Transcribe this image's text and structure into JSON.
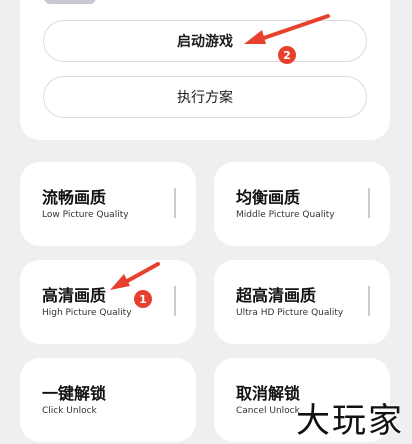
{
  "actions": {
    "launch_label": "启动游戏",
    "plan_label": "执行方案"
  },
  "tiles": [
    {
      "title": "流畅画质",
      "subtitle": "Low Picture Quality"
    },
    {
      "title": "均衡画质",
      "subtitle": "Middle Picture Quality"
    },
    {
      "title": "高清画质",
      "subtitle": "High Picture Quality"
    },
    {
      "title": "超高清画质",
      "subtitle": "Ultra HD Picture Quality"
    },
    {
      "title": "一键解锁",
      "subtitle": "Click Unlock"
    },
    {
      "title": "取消解锁",
      "subtitle": "Cancel Unlock"
    }
  ],
  "annotations": {
    "badge_1": "1",
    "badge_2": "2",
    "color": "#e8402f"
  },
  "watermark": "大玩家"
}
